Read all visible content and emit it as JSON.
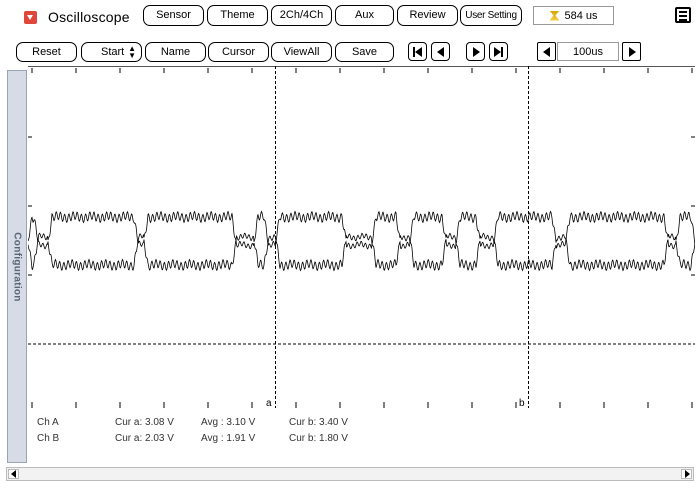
{
  "header": {
    "title": "Oscilloscope",
    "tabs": [
      "Sensor",
      "Theme",
      "2Ch/4Ch",
      "Aux",
      "Review",
      "User Setting"
    ],
    "time_display": "584 us"
  },
  "toolbar": {
    "reset": "Reset",
    "start": "Start",
    "name": "Name",
    "cursor": "Cursor",
    "viewall": "ViewAll",
    "save": "Save",
    "timebase": "100us"
  },
  "sidebar": {
    "label": "Configuration"
  },
  "plot": {
    "cursor_a_label": "a",
    "cursor_b_label": "b"
  },
  "readout": {
    "rows": [
      {
        "channel": "Ch A",
        "cur_a": "Cur a: 3.08 V",
        "avg": "Avg : 3.10 V",
        "cur_b": "Cur b: 3.40 V"
      },
      {
        "channel": "Ch B",
        "cur_a": "Cur a: 2.03 V",
        "avg": "Avg : 1.91 V",
        "cur_b": "Cur b: 1.80 V"
      }
    ]
  },
  "colors": {
    "accent": "#e0463a",
    "trace": "#000000",
    "sidebar": "#d6dbe6"
  }
}
